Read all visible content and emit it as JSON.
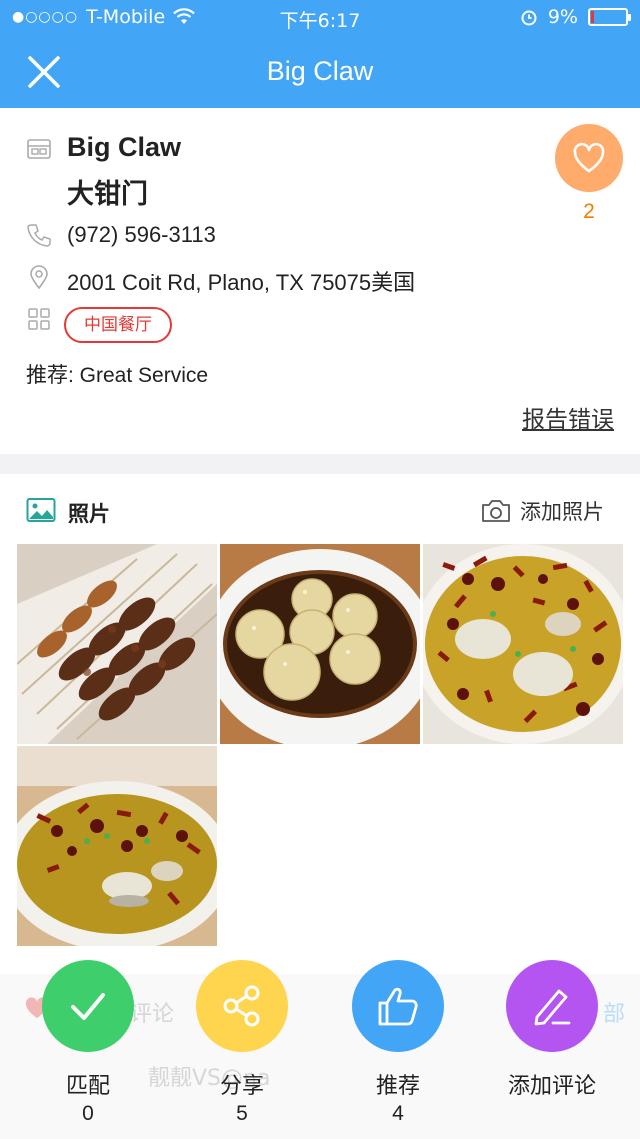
{
  "status_bar": {
    "carrier": "T-Mobile",
    "signal_dots": "●○○○○",
    "time": "下午6:17",
    "battery_percent": "9%",
    "battery_level": 0.09
  },
  "nav": {
    "title": "Big Claw"
  },
  "restaurant": {
    "name_en": "Big Claw",
    "name_cn": "大钳门",
    "phone": "(972) 596-3113",
    "address": "2001 Coit Rd, Plano, TX 75075美国",
    "category_tag": "中国餐厅",
    "recommend": "推荐: Great Service",
    "report_error": "报告错误",
    "likes": "2"
  },
  "photos": {
    "title": "照片",
    "add_label": "添加照片",
    "items": [
      "skewers",
      "dessert-balls",
      "spicy-fish-1",
      "spicy-fish-2"
    ]
  },
  "background_faded": {
    "review_label": "评论",
    "user_text": "靓靓VS@na",
    "right_text": "部"
  },
  "actions": [
    {
      "label": "匹配",
      "count": "0",
      "color": "#3ecf6c",
      "icon": "check-icon"
    },
    {
      "label": "分享",
      "count": "5",
      "color": "#ffd54f",
      "icon": "share-icon"
    },
    {
      "label": "推荐",
      "count": "4",
      "color": "#42a5f5",
      "icon": "thumbs-up-icon"
    },
    {
      "label": "添加评论",
      "count": "",
      "color": "#b455f2",
      "icon": "pencil-icon"
    }
  ],
  "colors": {
    "primary": "#42a5f5",
    "tag_red": "#e53935",
    "like_orange": "#ffab6b"
  }
}
